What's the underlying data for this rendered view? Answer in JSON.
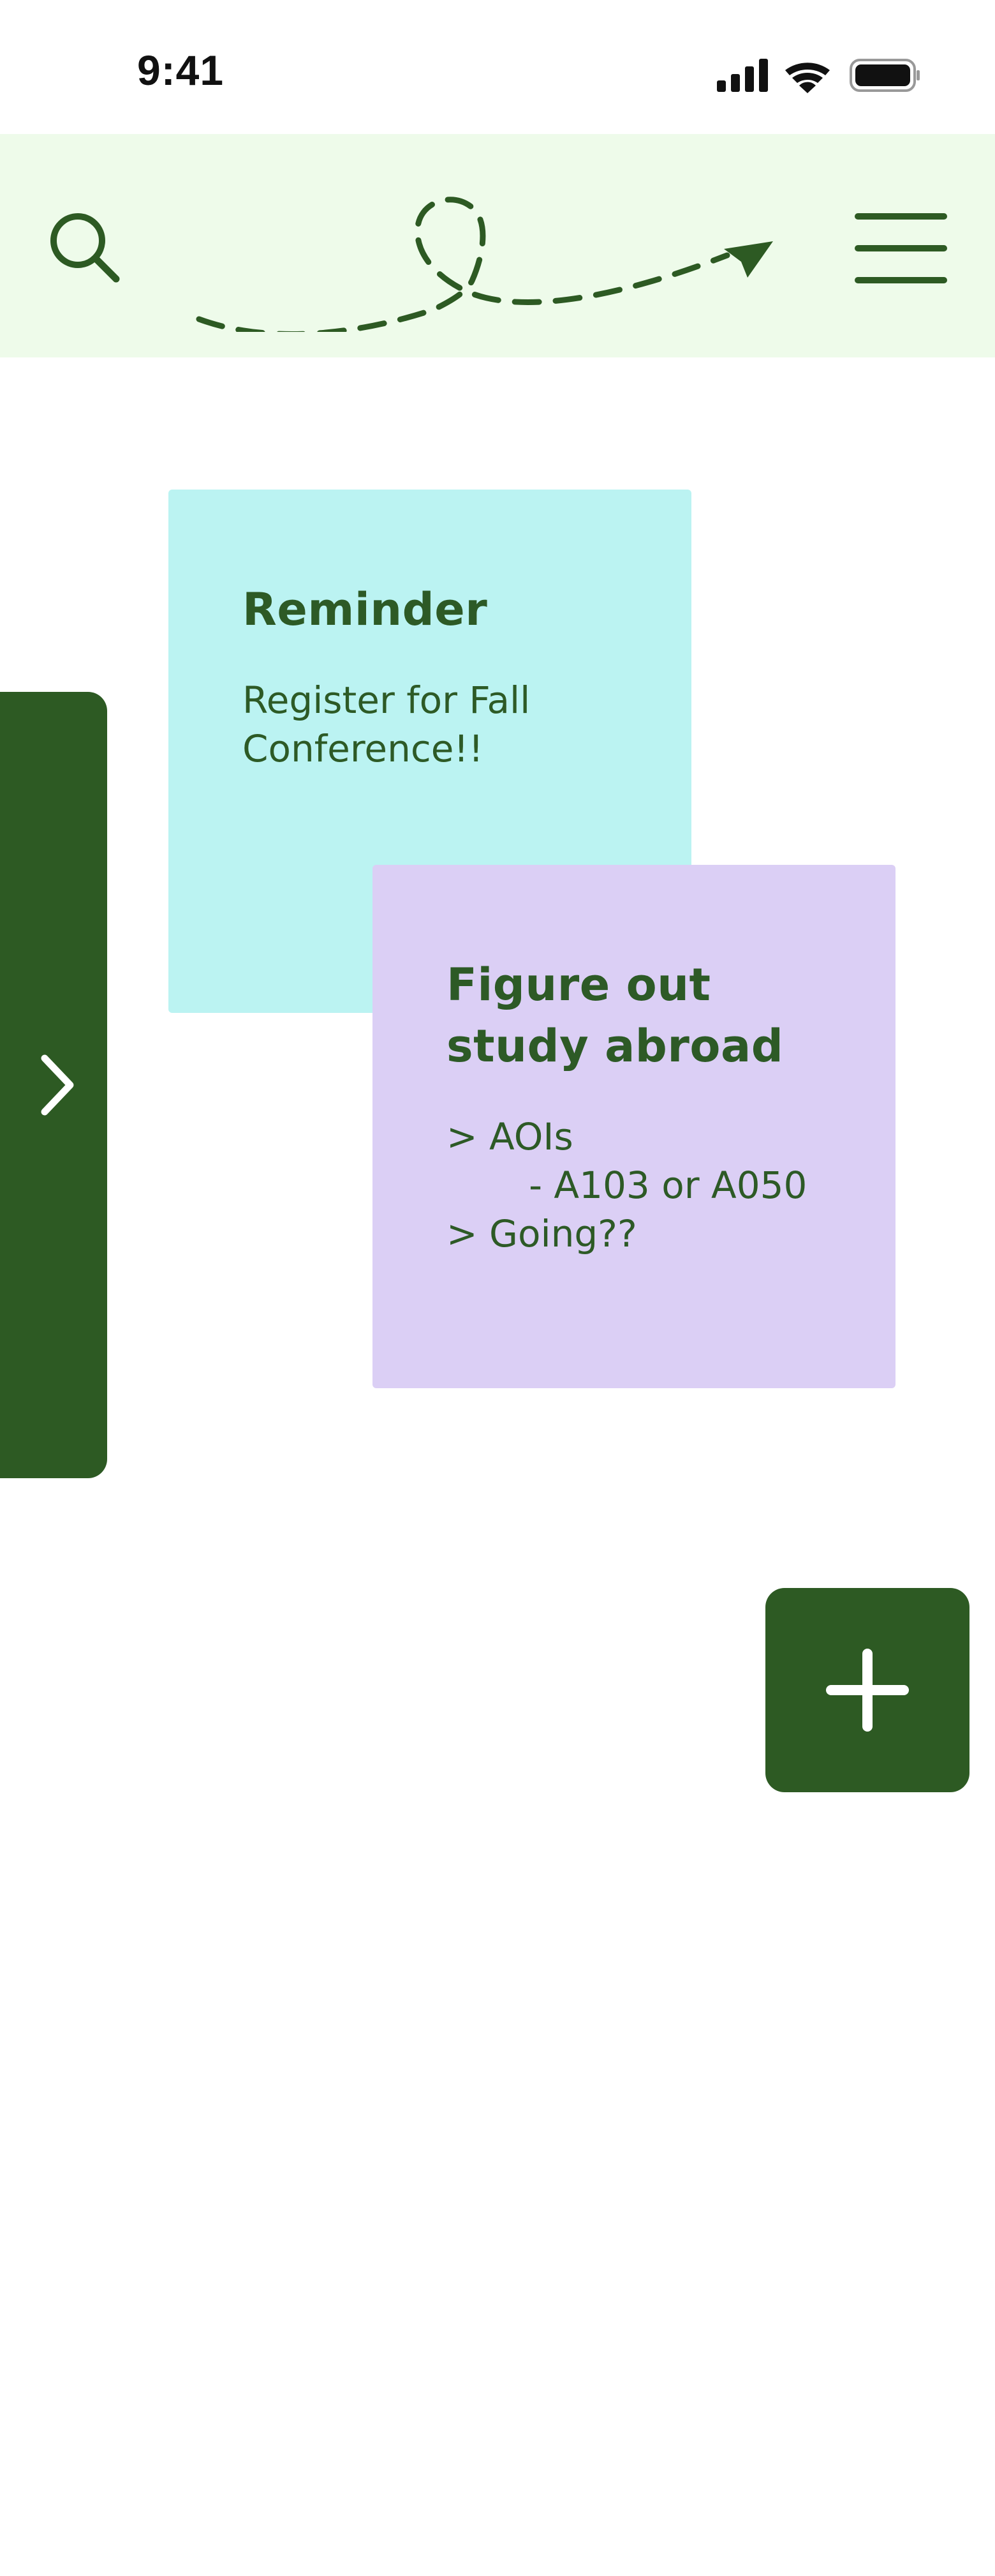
{
  "status_bar": {
    "time": "9:41",
    "icons": [
      "cellular-signal-icon",
      "wifi-icon",
      "battery-icon"
    ]
  },
  "header": {
    "icons": [
      "search-icon",
      "paper-plane-logo-icon",
      "hamburger-menu-icon"
    ]
  },
  "notes": [
    {
      "title": "Reminder",
      "body": "Register for Fall\nConference!!",
      "color": "#bbf3f2"
    },
    {
      "title": "Figure out\nstudy abroad",
      "body": "> AOIs\n       - A103 or A050\n> Going??",
      "color": "#dbcff5"
    }
  ],
  "side_drawer": {
    "icon": "chevron-right-icon"
  },
  "add_button": {
    "icon": "plus-icon"
  },
  "colors": {
    "brand_green": "#2d5a23",
    "header_bg": "#eefbea",
    "text_green": "#2d5a26"
  }
}
